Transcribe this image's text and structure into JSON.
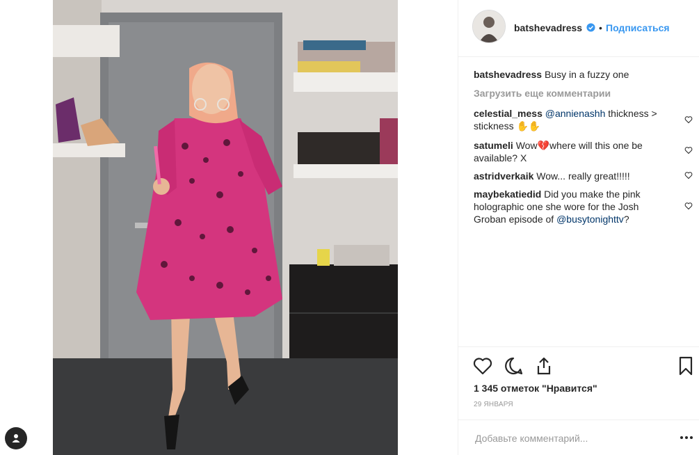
{
  "post": {
    "username": "batshevadress",
    "follow_label": "Подписаться",
    "dot": "•",
    "caption_user": "batshevadress",
    "caption_text": "Busy in a fuzzy one",
    "load_more": "Загрузить еще комментарии",
    "likes": "1 345 отметок \"Нравится\"",
    "date": "29 ЯНВАРЯ"
  },
  "comments": [
    {
      "user": "celestial_mess",
      "mention": "@annienashh",
      "text": " thickness > stickness ✋✋"
    },
    {
      "user": "satumeli",
      "text": " Wow💔where will this one be available? X"
    },
    {
      "user": "astridverkaik",
      "text": " Wow... really great!!!!!"
    },
    {
      "user": "maybekatiedid",
      "text": " Did you make the pink holographic one she wore for the Josh Groban episode of ",
      "mention": "@busytonighttv",
      "tail": "?"
    }
  ],
  "add_comment": {
    "placeholder": "Добавьте комментарий..."
  },
  "colors": {
    "accent": "#3897f0",
    "verified": "#3897f0",
    "mention": "#003569",
    "muted": "#999999"
  },
  "icons": [
    "user-tag-icon",
    "verified-icon",
    "heart-icon",
    "comment-icon",
    "share-icon",
    "bookmark-icon",
    "more-icon"
  ]
}
